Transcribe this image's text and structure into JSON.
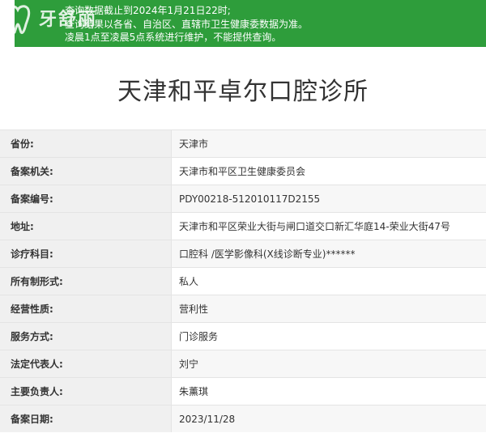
{
  "watermark": {
    "logo_text": "牙舒丽"
  },
  "notice": {
    "line1": "查询数据截止到2024年1月21日22时;",
    "line2": "查询结果以各省、自治区、直辖市卫生健康委数据为准。",
    "line3": "凌晨1点至凌晨5点系统进行维护，不能提供查询。"
  },
  "title": "天津和平卓尔口腔诊所",
  "rows": [
    {
      "label": "省份:",
      "value": "天津市"
    },
    {
      "label": "备案机关:",
      "value": "天津市和平区卫生健康委员会"
    },
    {
      "label": "备案编号:",
      "value": "PDY00218-512010117D2155"
    },
    {
      "label": "地址:",
      "value": "天津市和平区荣业大街与闸口道交口新汇华庭14-荣业大街47号"
    },
    {
      "label": "诊疗科目:",
      "value": "口腔科 /医学影像科(X线诊断专业)******"
    },
    {
      "label": "所有制形式:",
      "value": "私人"
    },
    {
      "label": "经营性质:",
      "value": "营利性"
    },
    {
      "label": "服务方式:",
      "value": "门诊服务"
    },
    {
      "label": "法定代表人:",
      "value": "刘宁"
    },
    {
      "label": "主要负责人:",
      "value": "朱薰琪"
    },
    {
      "label": "备案日期:",
      "value": "2023/11/28"
    }
  ]
}
